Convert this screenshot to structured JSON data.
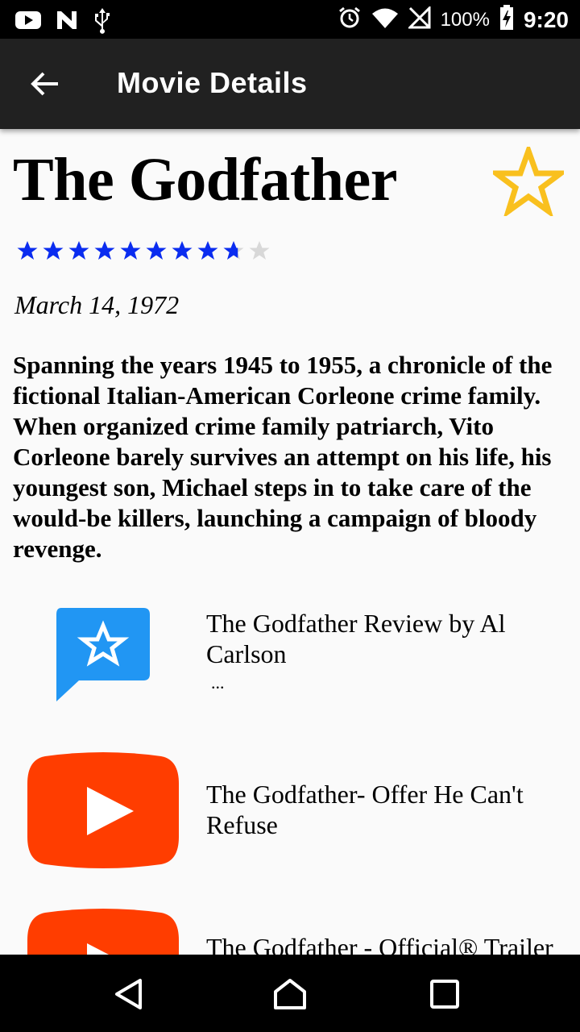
{
  "status_bar": {
    "left_icons": [
      "youtube-icon",
      "n-icon",
      "usb-icon"
    ],
    "right_icons": [
      "alarm-icon",
      "wifi-icon",
      "no-signal-icon",
      "battery-charging-icon"
    ],
    "battery": "100%",
    "time": "9:20"
  },
  "app_bar": {
    "title": "Movie Details",
    "back_icon": "arrow-back-icon"
  },
  "movie": {
    "title": "The Godfather",
    "rating": 8.7,
    "rating_max": 10,
    "release_date": "March 14, 1972",
    "overview": "Spanning the years 1945 to 1955, a chronicle of the fictional Italian-American Corleone crime family. When organized crime family patriarch, Vito Corleone barely survives an attempt on his life, his youngest son, Michael steps in to take care of the would-be killers, launching a campaign of bloody revenge.",
    "favorite_icon": "star-outline-icon"
  },
  "media": [
    {
      "type": "review",
      "icon": "review-icon",
      "title": "The Godfather Review by Al Carlson",
      "subtitle": "..."
    },
    {
      "type": "video",
      "icon": "youtube-play-icon",
      "title": "The Godfather- Offer He Can't Refuse"
    },
    {
      "type": "video",
      "icon": "youtube-play-icon",
      "title": "The Godfather - Official® Trailer [HD]"
    }
  ],
  "colors": {
    "rating_star": "#0a2cf0",
    "rating_empty": "#d8d8d8",
    "favorite_star": "#f9c01e",
    "review_blue": "#2196f3",
    "youtube_red": "#ff3d00",
    "app_bar": "#212121"
  },
  "nav_bar": {
    "back": "nav-back-icon",
    "home": "nav-home-icon",
    "recents": "nav-recents-icon"
  }
}
